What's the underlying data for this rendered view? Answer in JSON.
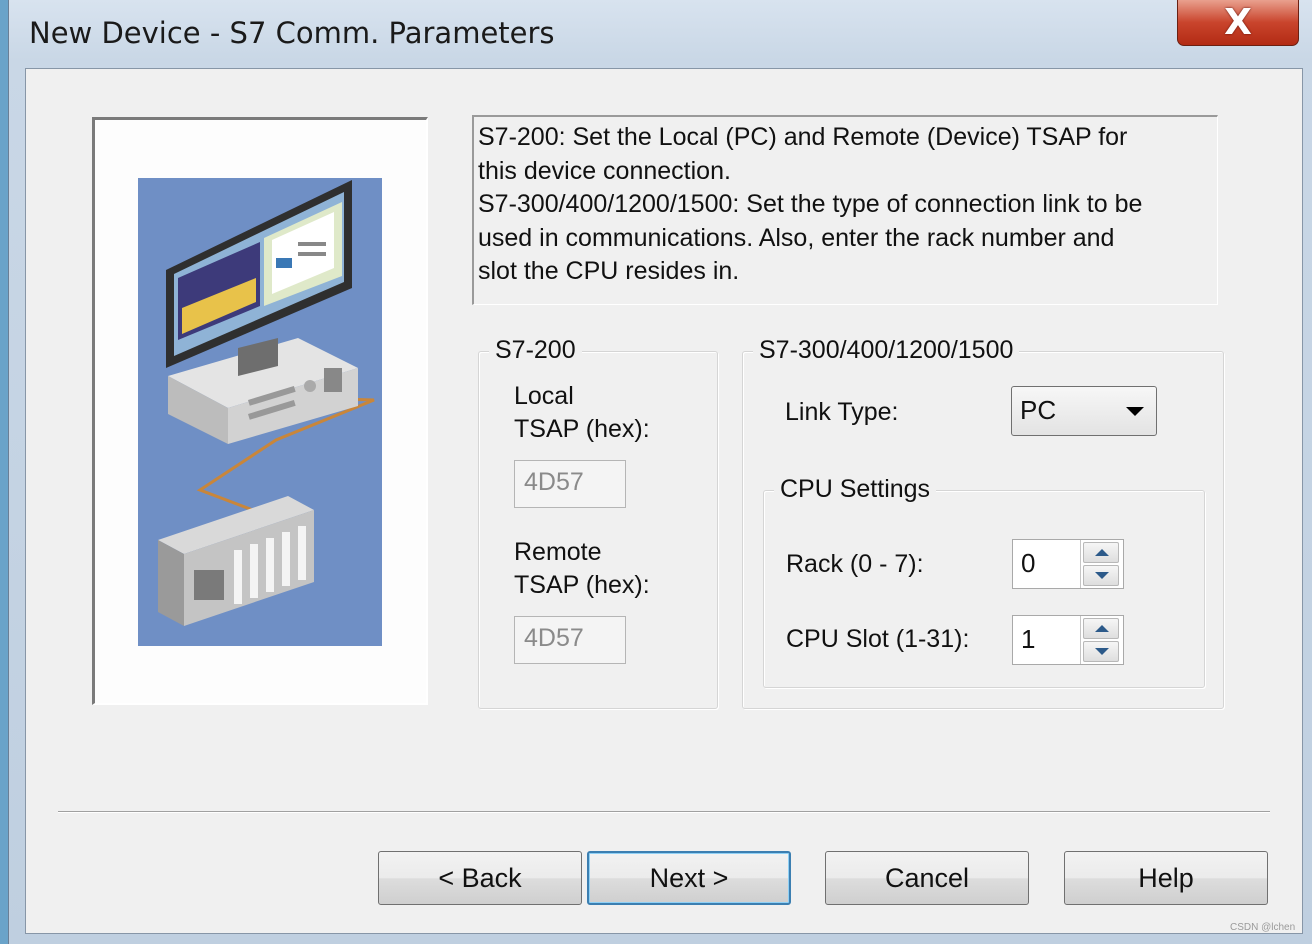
{
  "window": {
    "title": "New Device - S7 Comm. Parameters",
    "close_glyph": "X"
  },
  "description": "S7-200: Set the Local (PC) and Remote (Device) TSAP for\nthis device connection.\nS7-300/400/1200/1500: Set the type of connection link to be\nused in communications.  Also, enter the rack number and\nslot the CPU resides in.",
  "s7_200": {
    "group_title": "S7-200",
    "local_label": "Local\nTSAP (hex):",
    "local_value": "4D57",
    "remote_label": "Remote\nTSAP (hex):",
    "remote_value": "4D57"
  },
  "s7_300": {
    "group_title": "S7-300/400/1200/1500",
    "link_type_label": "Link Type:",
    "link_type_value": "PC",
    "cpu_settings": {
      "group_title": "CPU Settings",
      "rack_label": "Rack (0 - 7):",
      "rack_value": "0",
      "slot_label": "CPU Slot (1-31):",
      "slot_value": "1"
    }
  },
  "buttons": {
    "back": "< Back",
    "next": "Next >",
    "cancel": "Cancel",
    "help": "Help"
  },
  "watermark": "CSDN @lchen",
  "illustration": {
    "icon": "pc-to-plc-connection-illustration",
    "background": "#6f8fc5"
  }
}
